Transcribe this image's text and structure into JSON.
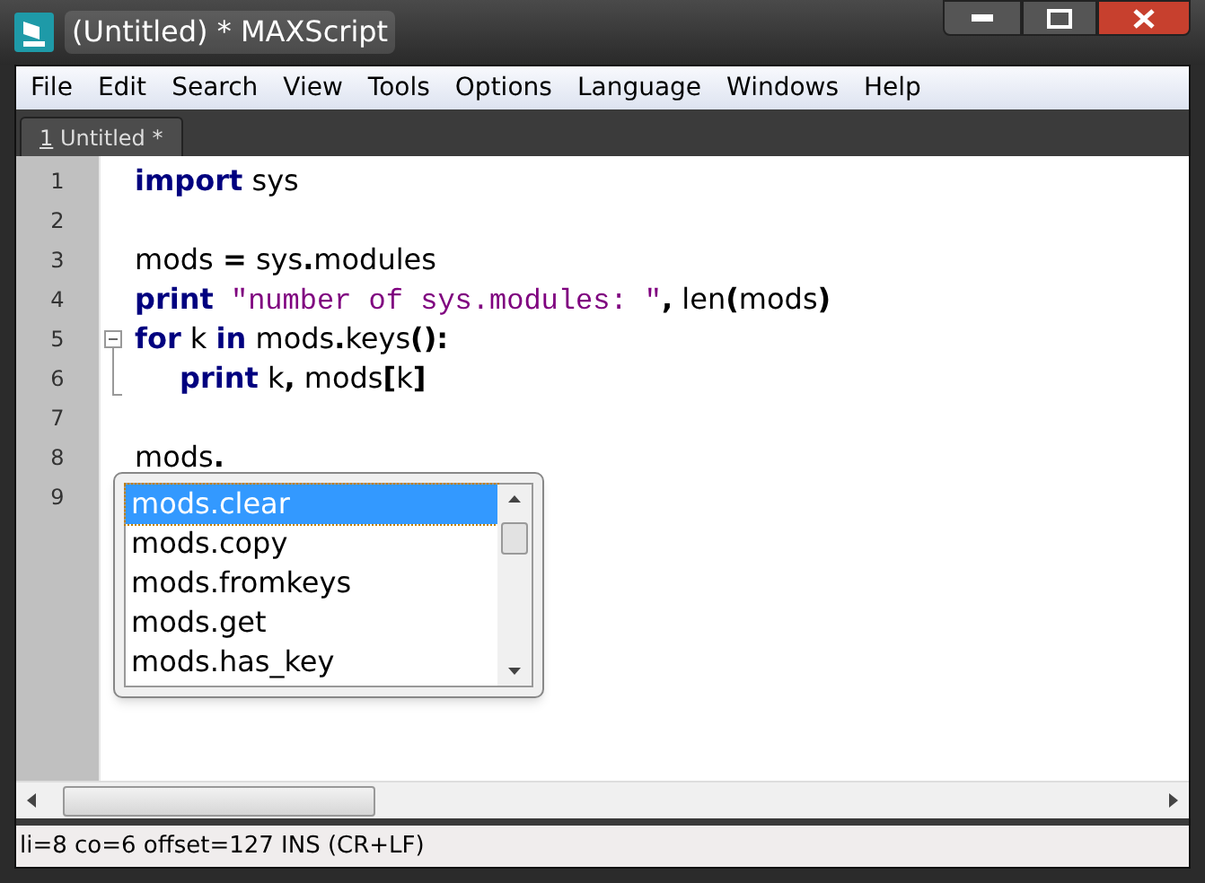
{
  "window": {
    "title": "(Untitled) * MAXScript"
  },
  "menu": [
    "File",
    "Edit",
    "Search",
    "View",
    "Tools",
    "Options",
    "Language",
    "Windows",
    "Help"
  ],
  "tabs": [
    {
      "number": "1",
      "label": " Untitled *",
      "selected": true
    }
  ],
  "lines": [
    {
      "number": "1",
      "tokens": [
        {
          "text": "import",
          "kind": "keyword"
        },
        {
          "text": " sys",
          "kind": "plain"
        }
      ]
    },
    {
      "number": "2"
    },
    {
      "number": "3",
      "tokens": [
        {
          "text": "mods ",
          "kind": "plain"
        },
        {
          "text": "=",
          "kind": "operator"
        },
        {
          "text": " sys",
          "kind": "plain"
        },
        {
          "text": ".",
          "kind": "operator"
        },
        {
          "text": "modules",
          "kind": "plain"
        }
      ]
    },
    {
      "number": "4",
      "tokens": [
        {
          "text": "print",
          "kind": "keyword"
        },
        {
          "text": " \"number of sys.modules: \"",
          "kind": "string"
        },
        {
          "text": ",",
          "kind": "operator"
        },
        {
          "text": " len",
          "kind": "plain"
        },
        {
          "text": "(",
          "kind": "operator"
        },
        {
          "text": "mods",
          "kind": "plain"
        },
        {
          "text": ")",
          "kind": "operator"
        }
      ]
    },
    {
      "number": "5",
      "fold_start": true,
      "tokens": [
        {
          "text": "for",
          "kind": "keyword"
        },
        {
          "text": " k ",
          "kind": "plain"
        },
        {
          "text": "in",
          "kind": "keyword"
        },
        {
          "text": " mods",
          "kind": "plain"
        },
        {
          "text": ".",
          "kind": "operator"
        },
        {
          "text": "keys",
          "kind": "plain"
        },
        {
          "text": "():",
          "kind": "operator"
        }
      ]
    },
    {
      "number": "6",
      "fold_end": true,
      "indent": true,
      "tokens": [
        {
          "text": "print",
          "kind": "keyword"
        },
        {
          "text": " k",
          "kind": "plain"
        },
        {
          "text": ",",
          "kind": "operator"
        },
        {
          "text": " mods",
          "kind": "plain"
        },
        {
          "text": "[",
          "kind": "operator"
        },
        {
          "text": "k",
          "kind": "plain"
        },
        {
          "text": "]",
          "kind": "operator"
        }
      ]
    },
    {
      "number": "7"
    },
    {
      "number": "8",
      "tokens": [
        {
          "text": "mods",
          "kind": "plain"
        },
        {
          "text": ".",
          "kind": "operator"
        }
      ]
    },
    {
      "number": "9"
    }
  ],
  "autocomplete": [
    {
      "label": "mods.clear",
      "selected": true
    },
    {
      "label": "mods.copy",
      "selected": false
    },
    {
      "label": "mods.fromkeys",
      "selected": false
    },
    {
      "label": "mods.get",
      "selected": false
    },
    {
      "label": "mods.has_key",
      "selected": false
    }
  ],
  "status_bar": "li=8 co=6 offset=127 INS (CR+LF)"
}
